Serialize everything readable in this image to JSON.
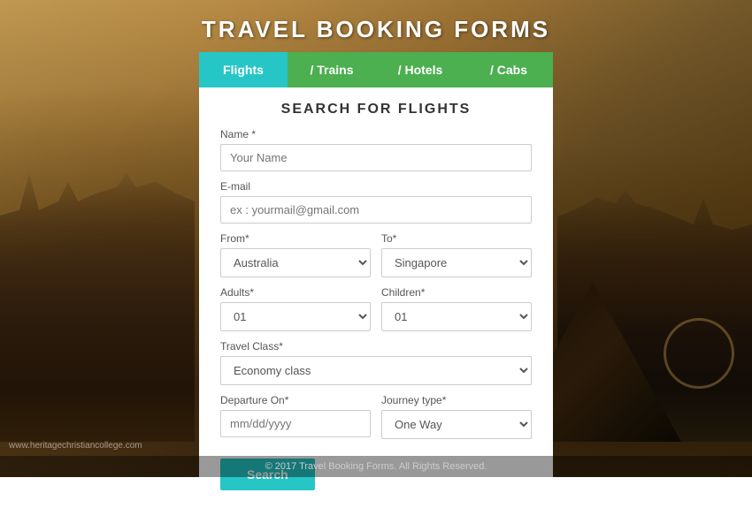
{
  "page": {
    "title": "TRAVEL BOOKING FORMS",
    "footer": "© 2017 Travel Booking Forms. All Rights Reserved.",
    "watermark": "www.heritagechristiancollege.com"
  },
  "tabs": [
    {
      "id": "flights",
      "label": "Flights",
      "active": true
    },
    {
      "id": "trains",
      "label": "/ Trains",
      "active": false
    },
    {
      "id": "hotels",
      "label": "/ Hotels",
      "active": false
    },
    {
      "id": "cabs",
      "label": "/ Cabs",
      "active": false
    }
  ],
  "form": {
    "title": "SEARCH  FOR  FLIGHTS",
    "fields": {
      "name_label": "Name *",
      "name_placeholder": "Your Name",
      "email_label": "E-mail",
      "email_placeholder": "ex : yourmail@gmail.com",
      "from_label": "From*",
      "from_value": "Australia",
      "to_label": "To*",
      "to_value": "Singapore",
      "adults_label": "Adults*",
      "adults_value": "01",
      "children_label": "Children*",
      "children_value": "01",
      "travel_class_label": "Travel Class*",
      "travel_class_value": "Economy class",
      "departure_label": "Departure On*",
      "departure_placeholder": "mm/dd/yyyy",
      "journey_label": "Journey type*",
      "journey_value": "One Way"
    },
    "search_button": "Search"
  }
}
